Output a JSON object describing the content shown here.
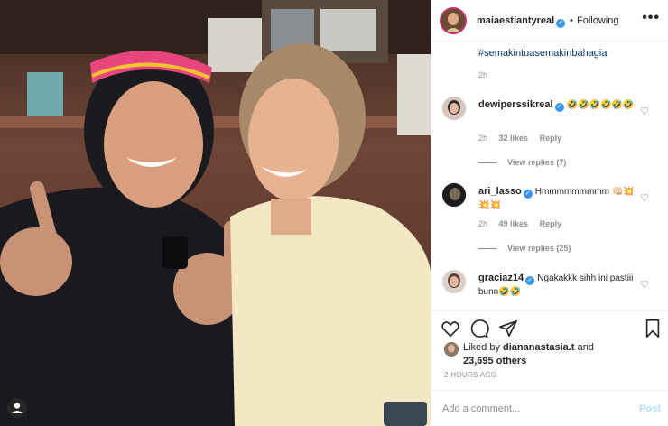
{
  "post": {
    "user_tag_icon": "user-tag-icon"
  },
  "header": {
    "username": "maiaestiantyreal",
    "verified": "✓",
    "separator": "•",
    "following_label": "Following",
    "more_icon": "•••"
  },
  "caption": {
    "tail": "#semakintuasemakinbahagia",
    "time": "2h"
  },
  "comments": [
    {
      "username": "dewiperssikreal",
      "text": "🤣🤣🤣🤣🤣🤣",
      "time": "2h",
      "likes": "32 likes",
      "reply": "Reply",
      "view_replies": "View replies (7)"
    },
    {
      "username": "ari_lasso",
      "text": "Hmmmmmmmmm 👊🏻💥💥💥",
      "time": "2h",
      "likes": "49 likes",
      "reply": "Reply",
      "view_replies": "View replies (25)"
    },
    {
      "username": "graciaz14",
      "text": "Ngakakkk sihh ini pastiii bunn🤣🤣"
    }
  ],
  "actions": {
    "like_icon": "heart-icon",
    "comment_icon": "comment-icon",
    "share_icon": "share-icon",
    "save_icon": "bookmark-icon"
  },
  "likes": {
    "prefix": "Liked by ",
    "user": "diananastasia.t",
    "and": " and",
    "count": "23,695 others"
  },
  "time_ago": "2 HOURS AGO",
  "add_comment": {
    "placeholder": "Add a comment...",
    "post_label": "Post"
  },
  "colors": {
    "link_blue": "#00376b",
    "verified_blue": "#3897f0",
    "muted": "#8e8e8e",
    "post_disabled": "#b2dffc"
  }
}
